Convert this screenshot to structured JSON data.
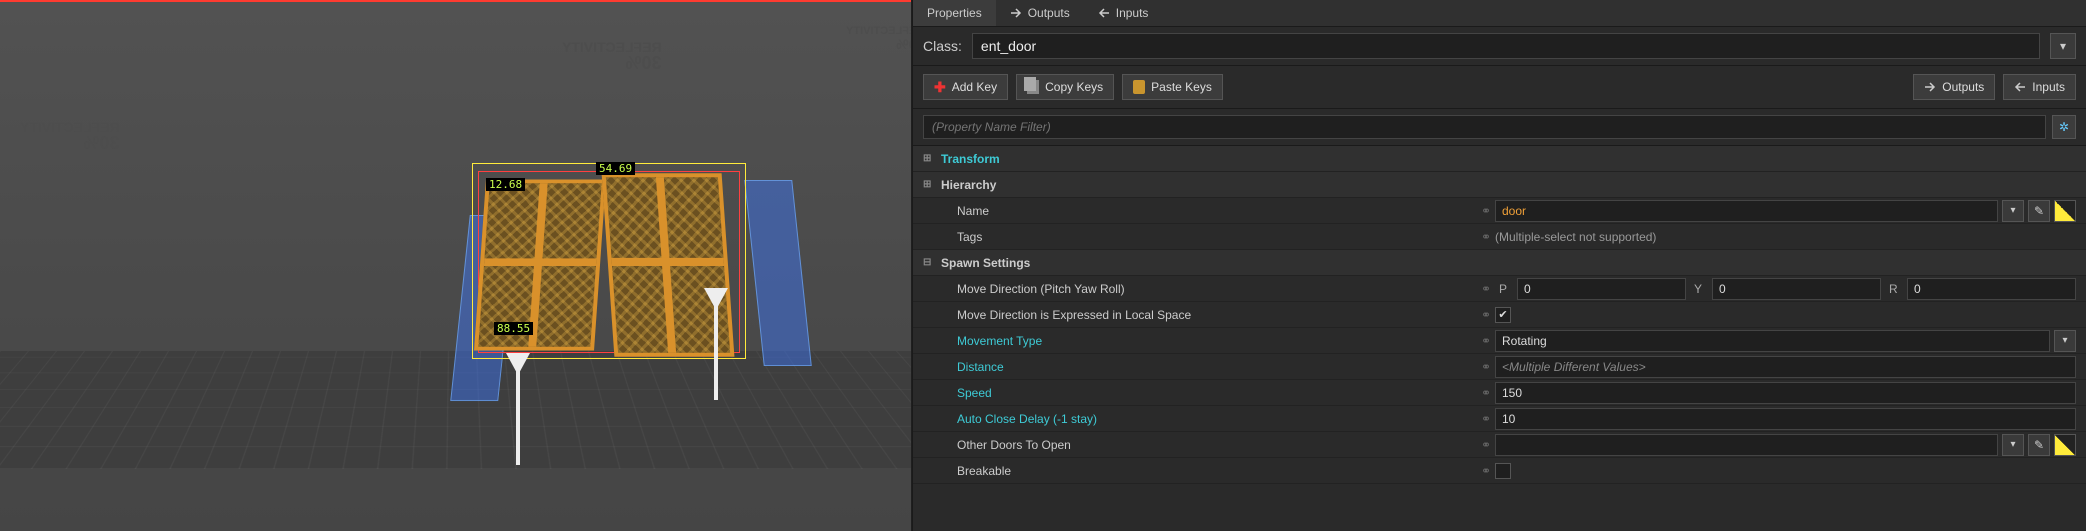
{
  "viewport": {
    "wall_texture_label": "REFLECTIVITY",
    "wall_texture_value": "30%",
    "dim_top": "54.69",
    "dim_left_a": "12.68",
    "dim_left_b": "88.55"
  },
  "tabs": {
    "properties": "Properties",
    "outputs": "Outputs",
    "inputs": "Inputs"
  },
  "class_row": {
    "label": "Class:",
    "value": "ent_door"
  },
  "key_toolbar": {
    "add_key": "Add Key",
    "copy_keys": "Copy Keys",
    "paste_keys": "Paste Keys",
    "outputs_btn": "Outputs",
    "inputs_btn": "Inputs"
  },
  "filter": {
    "placeholder": "(Property Name Filter)"
  },
  "sections": {
    "transform": "Transform",
    "hierarchy": "Hierarchy",
    "spawn_settings": "Spawn Settings"
  },
  "rows": {
    "name": {
      "label": "Name",
      "value": "door"
    },
    "tags": {
      "label": "Tags",
      "note": "(Multiple-select not supported)"
    },
    "move_dir": {
      "label": "Move Direction (Pitch Yaw Roll)",
      "p_label": "P",
      "p": "0",
      "y_label": "Y",
      "y": "0",
      "r_label": "R",
      "r": "0"
    },
    "local_space": {
      "label": "Move Direction is Expressed in Local Space",
      "checked": true
    },
    "movement_type": {
      "label": "Movement Type",
      "value": "Rotating"
    },
    "distance": {
      "label": "Distance",
      "value": "<Multiple Different Values>"
    },
    "speed": {
      "label": "Speed",
      "value": "150"
    },
    "auto_close": {
      "label": "Auto Close Delay (-1 stay)",
      "value": "10"
    },
    "other_doors": {
      "label": "Other Doors To Open",
      "value": ""
    },
    "breakable": {
      "label": "Breakable",
      "checked": false
    }
  }
}
